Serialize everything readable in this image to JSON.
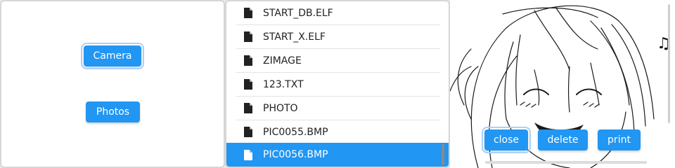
{
  "left_panel": {
    "camera_label": "Camera",
    "photos_label": "Photos"
  },
  "file_list": {
    "items": [
      {
        "name": "START_DB.ELF",
        "icon": "file-icon"
      },
      {
        "name": "START_X.ELF",
        "icon": "file-icon"
      },
      {
        "name": "ZIMAGE",
        "icon": "file-icon"
      },
      {
        "name": "123.TXT",
        "icon": "file-icon"
      },
      {
        "name": "PHOTO",
        "icon": "file-icon"
      },
      {
        "name": "PIC0055.BMP",
        "icon": "file-icon"
      },
      {
        "name": "PIC0056.BMP",
        "icon": "file-icon",
        "selected": true
      }
    ]
  },
  "viewer": {
    "close_label": "close",
    "delete_label": "delete",
    "print_label": "print",
    "decoration": "music-note-icon"
  },
  "colors": {
    "accent": "#2196f3",
    "selected_row": "#2196f3"
  }
}
